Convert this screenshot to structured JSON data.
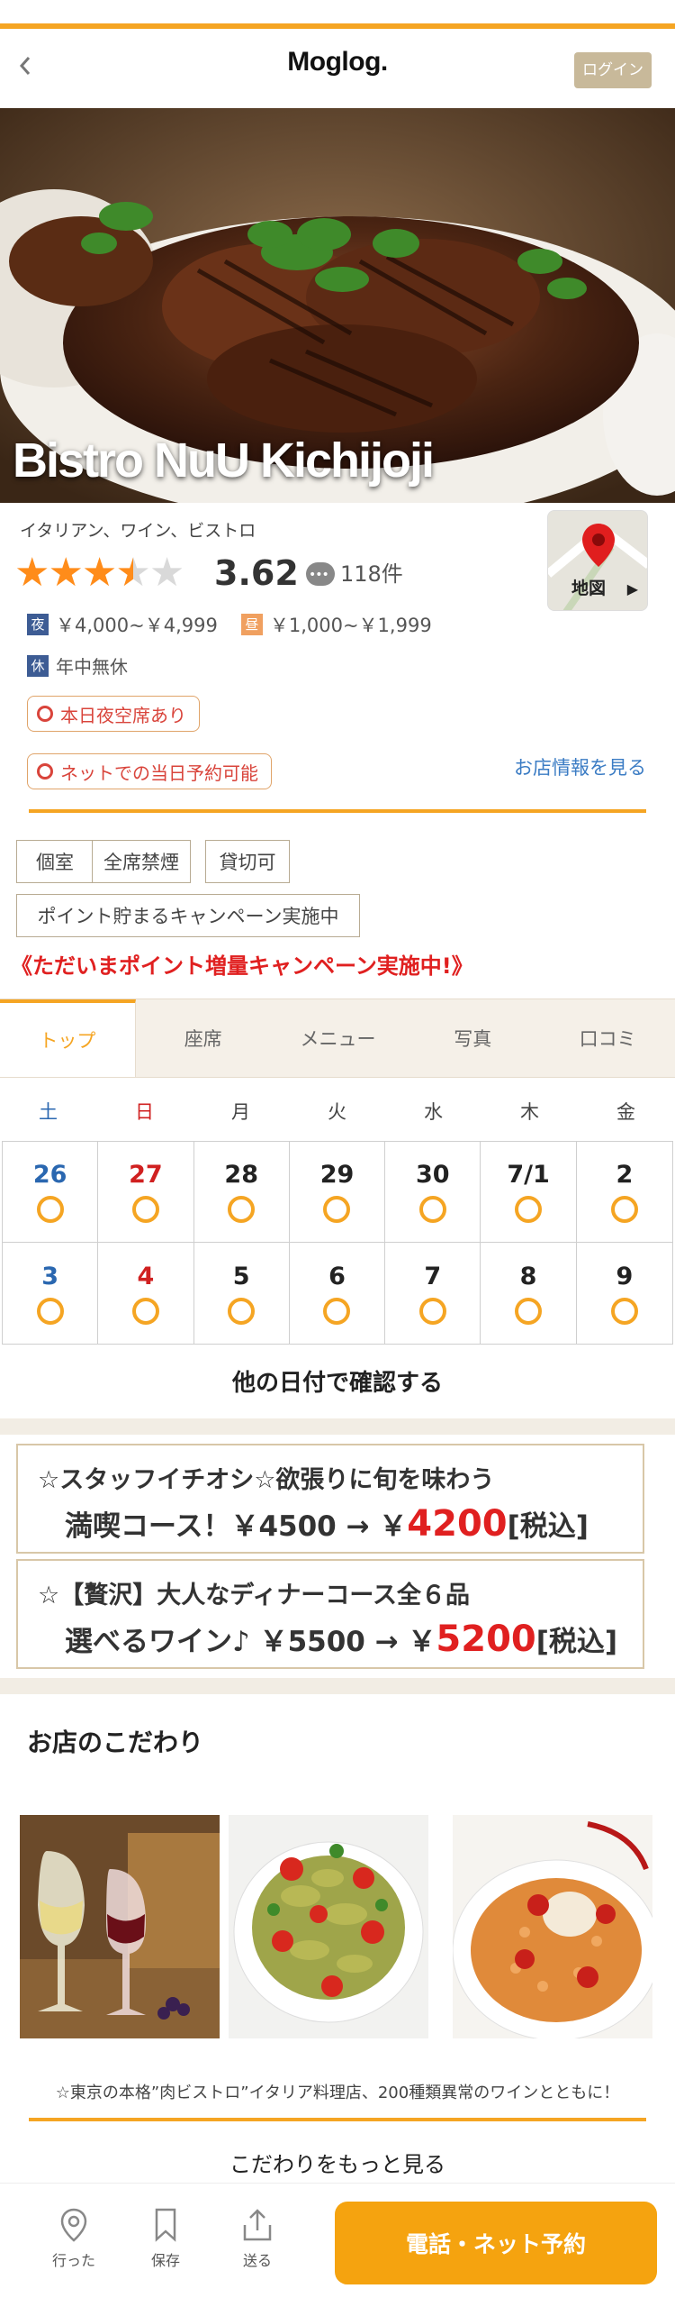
{
  "header": {
    "back_icon": "chevron-left-icon",
    "logo": "Moglog.",
    "login_label": "ログイン"
  },
  "hero": {
    "restaurant_name": "Bistro NuU Kichijoji"
  },
  "summary": {
    "genre": "イタリアン、ワイン、ビストロ",
    "rating": "3.62",
    "rating_value": 3.62,
    "rating_max": 5,
    "review_count": "118件",
    "dinner_badge": "夜",
    "dinner_price": "￥4,000~￥4,999",
    "lunch_badge": "昼",
    "lunch_price": "￥1,000~￥1,999",
    "holiday_badge": "休",
    "holiday_text": "年中無休",
    "availability_tag": "本日夜空席あり",
    "online_tag": "ネットでの当日予約可能",
    "shop_info_link": "お店情報を見る",
    "map_label": "地図",
    "map_arrow": "▶"
  },
  "features": {
    "tags": [
      "個室",
      "全席禁煙",
      "貸切可"
    ],
    "point_tag": "ポイント貯まるキャンペーン実施中",
    "campaign": "《ただいまポイント増量キャンペーン実施中!》"
  },
  "tabs": [
    "トップ",
    "座席",
    "メニュー",
    "写真",
    "口コミ"
  ],
  "calendar": {
    "days_of_week": [
      "土",
      "日",
      "月",
      "火",
      "水",
      "木",
      "金"
    ],
    "dates": [
      "26",
      "27",
      "28",
      "29",
      "30",
      "7/1",
      "2",
      "3",
      "4",
      "5",
      "6",
      "7",
      "8",
      "9"
    ],
    "other_dates_label": "他の日付で確認する"
  },
  "courses": [
    {
      "line1": "☆スタッフイチオシ☆欲張りに旬を味わう",
      "line2_prefix": "満喫コース！￥4500 → ￥",
      "line2_price": "4200",
      "line2_suffix": "[税込]"
    },
    {
      "line1": "☆【贅沢】大人なディナーコース全６品",
      "line2_prefix": "選べるワイン♪ ￥5500 → ￥",
      "line2_price": "5200",
      "line2_suffix": "[税込]"
    }
  ],
  "kodawari": {
    "title": "お店のこだわり",
    "caption": "☆東京の本格”肉ビストロ”イタリア料理店、200種類異常のワインとともに！",
    "more_label": "こだわりをもっと見る"
  },
  "bottom_bar": {
    "went_label": "行った",
    "save_label": "保存",
    "send_label": "送る",
    "reserve_label": "電話・ネット予約"
  },
  "colors": {
    "accent": "#f5a523",
    "reserve_button": "#f5a30f",
    "red": "#e02020",
    "link_blue": "#3b7cc4",
    "night_badge": "#3d5c94"
  }
}
